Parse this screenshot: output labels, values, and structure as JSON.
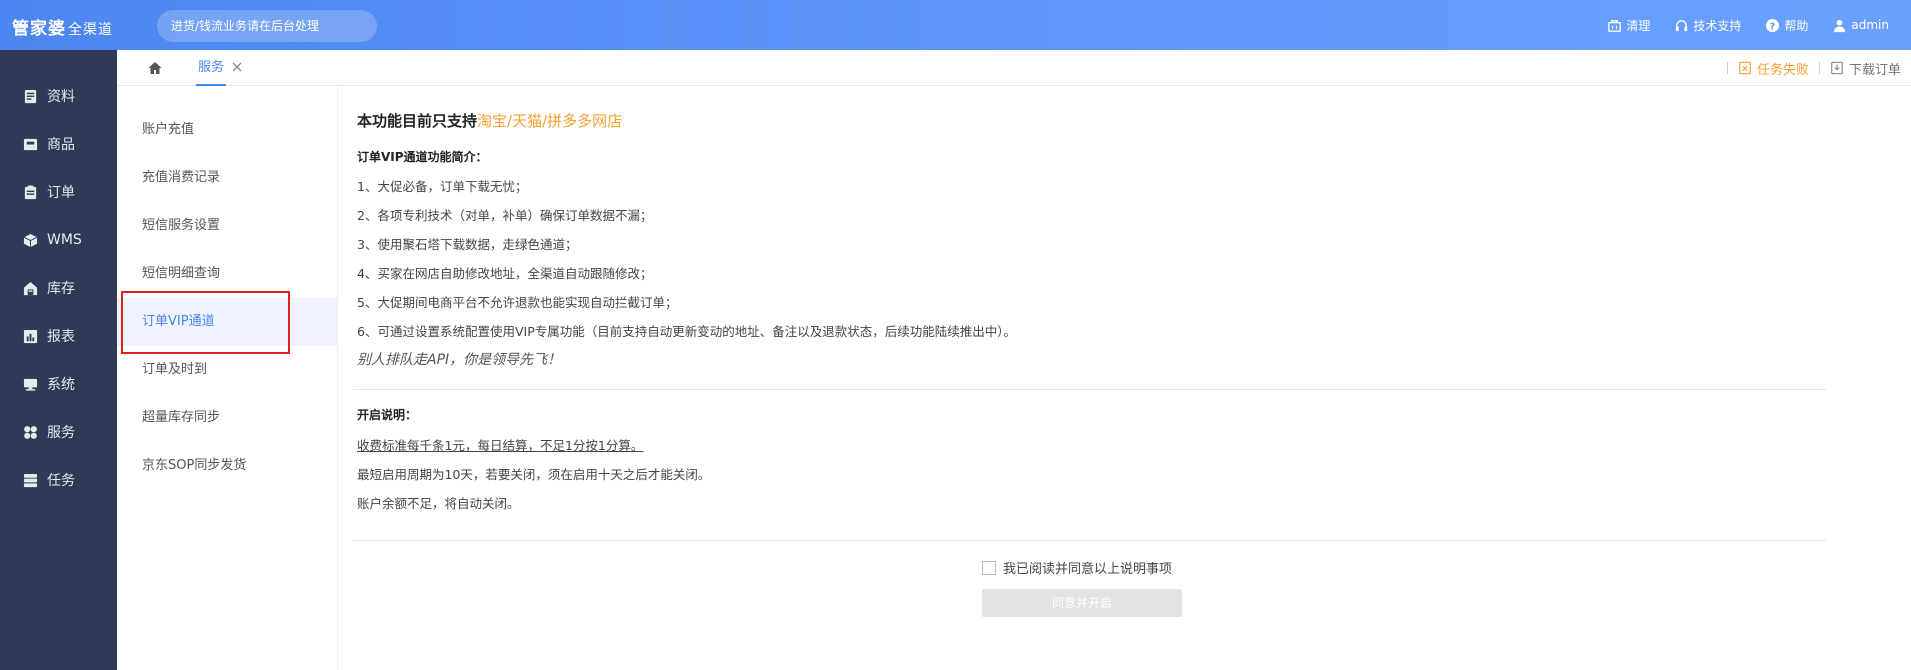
{
  "header": {
    "logo": "管家婆",
    "logo_sub": "全渠道",
    "notice": "进货/钱流业务请在后台处理",
    "actions": [
      {
        "icon": "clear-icon",
        "label": "清理"
      },
      {
        "icon": "headset-icon",
        "label": "技术支持"
      },
      {
        "icon": "help-icon",
        "label": "帮助"
      },
      {
        "icon": "user-icon",
        "label": "admin"
      }
    ]
  },
  "sidebar": {
    "items": [
      {
        "icon": "profile-icon",
        "label": "资料"
      },
      {
        "icon": "product-icon",
        "label": "商品"
      },
      {
        "icon": "order-icon",
        "label": "订单"
      },
      {
        "icon": "wms-icon",
        "label": "WMS"
      },
      {
        "icon": "inventory-icon",
        "label": "库存"
      },
      {
        "icon": "report-icon",
        "label": "报表"
      },
      {
        "icon": "system-icon",
        "label": "系统"
      },
      {
        "icon": "service-icon",
        "label": "服务"
      },
      {
        "icon": "task-icon",
        "label": "任务"
      }
    ]
  },
  "tabs": {
    "current": "服务",
    "task_failed": "任务失败",
    "download_orders": "下载订单"
  },
  "submenu": {
    "items": [
      {
        "label": "账户充值",
        "active": false
      },
      {
        "label": "充值消费记录",
        "active": false
      },
      {
        "label": "短信服务设置",
        "active": false
      },
      {
        "label": "短信明细查询",
        "active": false
      },
      {
        "label": "订单VIP通道",
        "active": true
      },
      {
        "label": "订单及时到",
        "active": false
      },
      {
        "label": "超量库存同步",
        "active": false
      },
      {
        "label": "京东SOP同步发货",
        "active": false
      }
    ]
  },
  "main": {
    "heading_prefix": "本功能目前只支持",
    "heading_highlight": "淘宝/天猫/拼多多网店",
    "intro_title": "订单VIP通道功能简介：",
    "intro_lines": [
      "1、大促必备，订单下载无忧；",
      "2、各项专利技术（对单，补单）确保订单数据不漏；",
      "3、使用聚石塔下载数据，走绿色通道；",
      "4、买家在网店自助修改地址，全渠道自动跟随修改；",
      "5、大促期间电商平台不允许退款也能实现自动拦截订单；",
      "6、可通过设置系统配置使用VIP专属功能（目前支持自动更新变动的地址、备注以及退款状态，后续功能陆续推出中）。"
    ],
    "slogan": "别人排队走API，你是领导先飞！",
    "open_title": "开启说明：",
    "open_lines": [
      "收费标准每千条1元，每日结算，不足1分按1分算。",
      "最短启用周期为10天，若要关闭，须在启用十天之后才能关闭。",
      "账户余额不足，将自动关闭。"
    ],
    "agree_label": "我已阅读并同意以上说明事项",
    "agree_checked": false,
    "submit_label": "同意并开启"
  },
  "colors": {
    "header": "#5a93f8",
    "sidebar": "#2e3a56",
    "accent": "#4a86f0",
    "highlight": "#f5a033",
    "active_box": "#e02020"
  }
}
